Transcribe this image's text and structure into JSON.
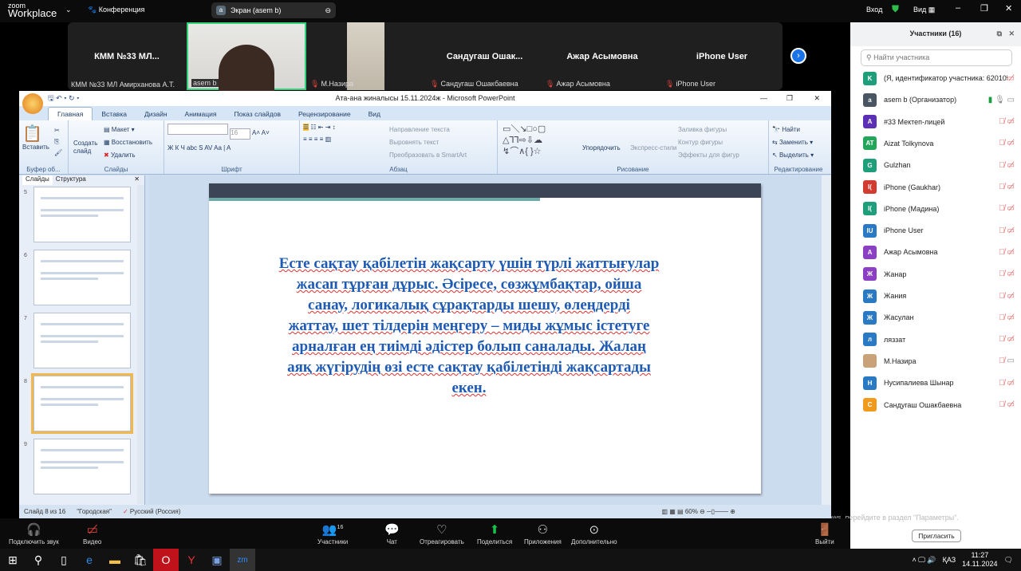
{
  "zoom": {
    "logo_small": "zoom",
    "logo_big": "Workplace",
    "meeting_label": "Конференция",
    "share_avatar": "a",
    "share_label": "Экран (asem b)",
    "signin": "Вход",
    "view": "Вид"
  },
  "video_tiles": [
    {
      "big": "КММ №33 МЛ...",
      "name": "КММ №33 МЛ Амирханова А.Т."
    },
    {
      "big": "",
      "name": "asem b"
    },
    {
      "big": "",
      "name": "М.Назира"
    },
    {
      "big": "Сандугаш  Ошак...",
      "name": "Сандугаш Ошакбаевна"
    },
    {
      "big": "Ажар Асымовна",
      "name": "Ажар Асымовна"
    },
    {
      "big": "iPhone User",
      "name": "iPhone User"
    }
  ],
  "participants": {
    "title": "Участники (16)",
    "search_placeholder": "Найти участника",
    "invite": "Пригласить",
    "list": [
      {
        "initials": "K",
        "color": "#1e9e7a",
        "name": "(Я, идентификатор участника: 620105)"
      },
      {
        "initials": "a",
        "color": "#4a5563",
        "name": "asem b (Организатор)"
      },
      {
        "initials": "A",
        "color": "#5b2fb6",
        "name": "#33 Мектеп-лицей"
      },
      {
        "initials": "AT",
        "color": "#24a65a",
        "name": "Aizat Tolkynova"
      },
      {
        "initials": "G",
        "color": "#1e9e7a",
        "name": "Gulzhan"
      },
      {
        "initials": "I(",
        "color": "#d23b2f",
        "name": "iPhone (Gaukhar)"
      },
      {
        "initials": "I(",
        "color": "#1e9e7a",
        "name": "iPhone (Мадина)"
      },
      {
        "initials": "IU",
        "color": "#2a79c4",
        "name": "iPhone User"
      },
      {
        "initials": "A",
        "color": "#8a3fc4",
        "name": "Ажар Асымовна"
      },
      {
        "initials": "Ж",
        "color": "#8a3fc4",
        "name": "Жанар"
      },
      {
        "initials": "Ж",
        "color": "#2a79c4",
        "name": "Жания"
      },
      {
        "initials": "Ж",
        "color": "#2a79c4",
        "name": "Жасулан"
      },
      {
        "initials": "л",
        "color": "#2a79c4",
        "name": "ляззат"
      },
      {
        "initials": "",
        "color": "#c9a27a",
        "name": "М.Назира"
      },
      {
        "initials": "Н",
        "color": "#2a79c4",
        "name": "Нусипалиева Шынар"
      },
      {
        "initials": "С",
        "color": "#f29a1c",
        "name": "Сандугаш Ошакбаевна"
      }
    ]
  },
  "ppt": {
    "title": "Ата-ана жиналысы 15.11.2024ж - Microsoft PowerPoint",
    "tabs": [
      "Главная",
      "Вставка",
      "Дизайн",
      "Анимация",
      "Показ слайдов",
      "Рецензирование",
      "Вид"
    ],
    "ribbon": {
      "paste": "Вставить",
      "clipboard": "Буфер об...",
      "new_slide": "Создать слайд",
      "layout": "Макет",
      "reset": "Восстановить",
      "delete": "Удалить",
      "slides_group": "Слайды",
      "font_size": "16",
      "font_group": "Шрифт",
      "text_dir": "Направление текста",
      "align_text": "Выровнять текст",
      "smartart": "Преобразовать в SmartArt",
      "para_group": "Абзац",
      "arrange": "Упорядочить",
      "quick_styles": "Экспресс-стили",
      "fill": "Заливка фигуры",
      "outline": "Контур фигуры",
      "effects": "Эффекты для фигур",
      "drawing_group": "Рисование",
      "find": "Найти",
      "replace": "Заменить",
      "select": "Выделить",
      "edit_group": "Редактирование"
    },
    "pane_tabs": [
      "Слайды",
      "Структура"
    ],
    "thumbs": [
      "5",
      "6",
      "7",
      "8",
      "9"
    ],
    "slide_lines": [
      "Есте сақтау қабілетін жақсарту үшін түрлі жаттығулар",
      "жасап тұрған дұрыс. Әсіресе, сөзжұмбақтар, ойша",
      "санау, логикалық сұрақтарды шешу, өлеңдерді",
      "жаттау, шет тілдерін  меңгеру – миды жұмыс істетуге",
      "арналған ең тиімді әдістер болып саналады. Жалаң",
      "аяқ жүгірудің өзі есте сақтау қабілетінді жақсартады",
      "екен."
    ],
    "status": {
      "slide": "Слайд 8 из 16",
      "theme": "\"Городская\"",
      "lang": "Русский (Россия)",
      "zoom": "60%"
    }
  },
  "toolbar": {
    "audio": "Подключить звук",
    "video": "Видео",
    "participants": "Участники",
    "count": "16",
    "chat": "Чат",
    "react": "Отреагировать",
    "share": "Поделиться",
    "apps": "Приложения",
    "more": "Дополнительно",
    "leave": "Выйти"
  },
  "watermark": "Чтобы активировать Windows, перейдите в раздел \"Параметры\".",
  "taskbar": {
    "lang": "ҚАЗ",
    "time": "11:27",
    "date": "14.11.2024"
  }
}
